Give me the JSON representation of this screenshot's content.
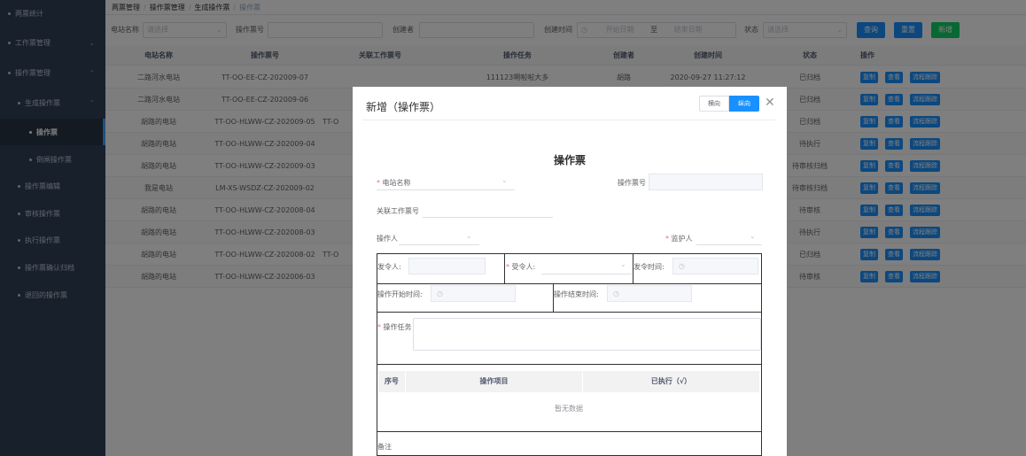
{
  "sidebar": {
    "items": [
      {
        "label": "两票统计",
        "chevron": ""
      },
      {
        "label": "工作票管理",
        "chevron": "⌄"
      },
      {
        "label": "操作票管理",
        "chevron": "⌃"
      },
      {
        "label": "生成操作票",
        "chevron": "⌃"
      },
      {
        "label": "操作票",
        "chevron": ""
      },
      {
        "label": "倒闸操作票",
        "chevron": ""
      },
      {
        "label": "操作票编辑",
        "chevron": ""
      },
      {
        "label": "审核操作票",
        "chevron": ""
      },
      {
        "label": "执行操作票",
        "chevron": ""
      },
      {
        "label": "操作票确认归档",
        "chevron": ""
      },
      {
        "label": "退回的操作票",
        "chevron": ""
      }
    ]
  },
  "breadcrumb": [
    "两票管理",
    "操作票管理",
    "生成操作票",
    "操作票"
  ],
  "search": {
    "station_label": "电站名称",
    "station_placeholder": "请选择",
    "ticket_no_label": "操作票号",
    "creator_label": "创建者",
    "created_time_label": "创建时间",
    "start_placeholder": "开始日期",
    "to_label": "至",
    "end_placeholder": "结束日期",
    "status_label": "状态",
    "status_placeholder": "请选择",
    "query_button": "查询",
    "reset_button": "重置",
    "add_button": "新增"
  },
  "table": {
    "headers": [
      "电站名称",
      "操作票号",
      "关联工作票号",
      "操作任务",
      "创建者",
      "创建时间",
      "状态",
      "操作"
    ],
    "actions": [
      "复制",
      "查看",
      "流程跟踪"
    ],
    "rows": [
      {
        "station": "二路河水电站",
        "ticket": "TT-OO-EE-CZ-202009-07",
        "work": "",
        "task": "111123啊啦啦大多",
        "creator": "胡路",
        "time": "2020-09-27 11:27:12",
        "status": "已归档"
      },
      {
        "station": "二路河水电站",
        "ticket": "TT-OO-EE-CZ-202009-06",
        "work": "",
        "task": "",
        "creator": "",
        "time": "",
        "status": "已归档"
      },
      {
        "station": "胡路的电站",
        "ticket": "TT-OO-HLWW-CZ-202009-05",
        "work": "TT-O",
        "task": "",
        "creator": "",
        "time": "",
        "status": "已归档"
      },
      {
        "station": "胡路的电站",
        "ticket": "TT-OO-HLWW-CZ-202009-04",
        "work": "",
        "task": "",
        "creator": "",
        "time": "",
        "status": "待执行"
      },
      {
        "station": "胡路的电站",
        "ticket": "TT-OO-HLWW-CZ-202009-03",
        "work": "",
        "task": "",
        "creator": "",
        "time": "",
        "status": "待审核归档"
      },
      {
        "station": "我是电站",
        "ticket": "LM-XS-WSDZ-CZ-202009-02",
        "work": "",
        "task": "",
        "creator": "",
        "time": "",
        "status": "待审核归档"
      },
      {
        "station": "胡路的电站",
        "ticket": "TT-OO-HLWW-CZ-202008-04",
        "work": "",
        "task": "",
        "creator": "",
        "time": "",
        "status": "待审核"
      },
      {
        "station": "胡路的电站",
        "ticket": "TT-OO-HLWW-CZ-202008-03",
        "work": "",
        "task": "",
        "creator": "",
        "time": "",
        "status": "待执行"
      },
      {
        "station": "胡路的电站",
        "ticket": "TT-OO-HLWW-CZ-202008-02",
        "work": "TT-O",
        "task": "",
        "creator": "",
        "time": "",
        "status": "已归档"
      },
      {
        "station": "胡路的电站",
        "ticket": "TT-OO-HLWW-CZ-202006-03",
        "work": "",
        "task": "",
        "creator": "",
        "time": "",
        "status": "待审核"
      }
    ]
  },
  "dialog": {
    "title": "新增（操作票）",
    "horizontal_label": "横向",
    "vertical_label": "纵向",
    "close_symbol": "✕",
    "form_title": "操作票",
    "station_label": "电站名称",
    "ticket_no_label": "操作票号",
    "related_work_label": "关联工作票号",
    "operator_label": "操作人",
    "guardian_label": "监护人",
    "issuer_label": "发令人:",
    "receiver_label": "受令人:",
    "issue_time_label": "发令时间:",
    "start_time_label": "操作开始时间:",
    "end_time_label": "操作结束时间:",
    "task_label": "操作任务",
    "items_headers": [
      "序号",
      "操作项目",
      "已执行（√）"
    ],
    "empty_text": "暂无数据",
    "remark_label": "备注",
    "clock_icon": "◷",
    "chevron": "⌄"
  }
}
